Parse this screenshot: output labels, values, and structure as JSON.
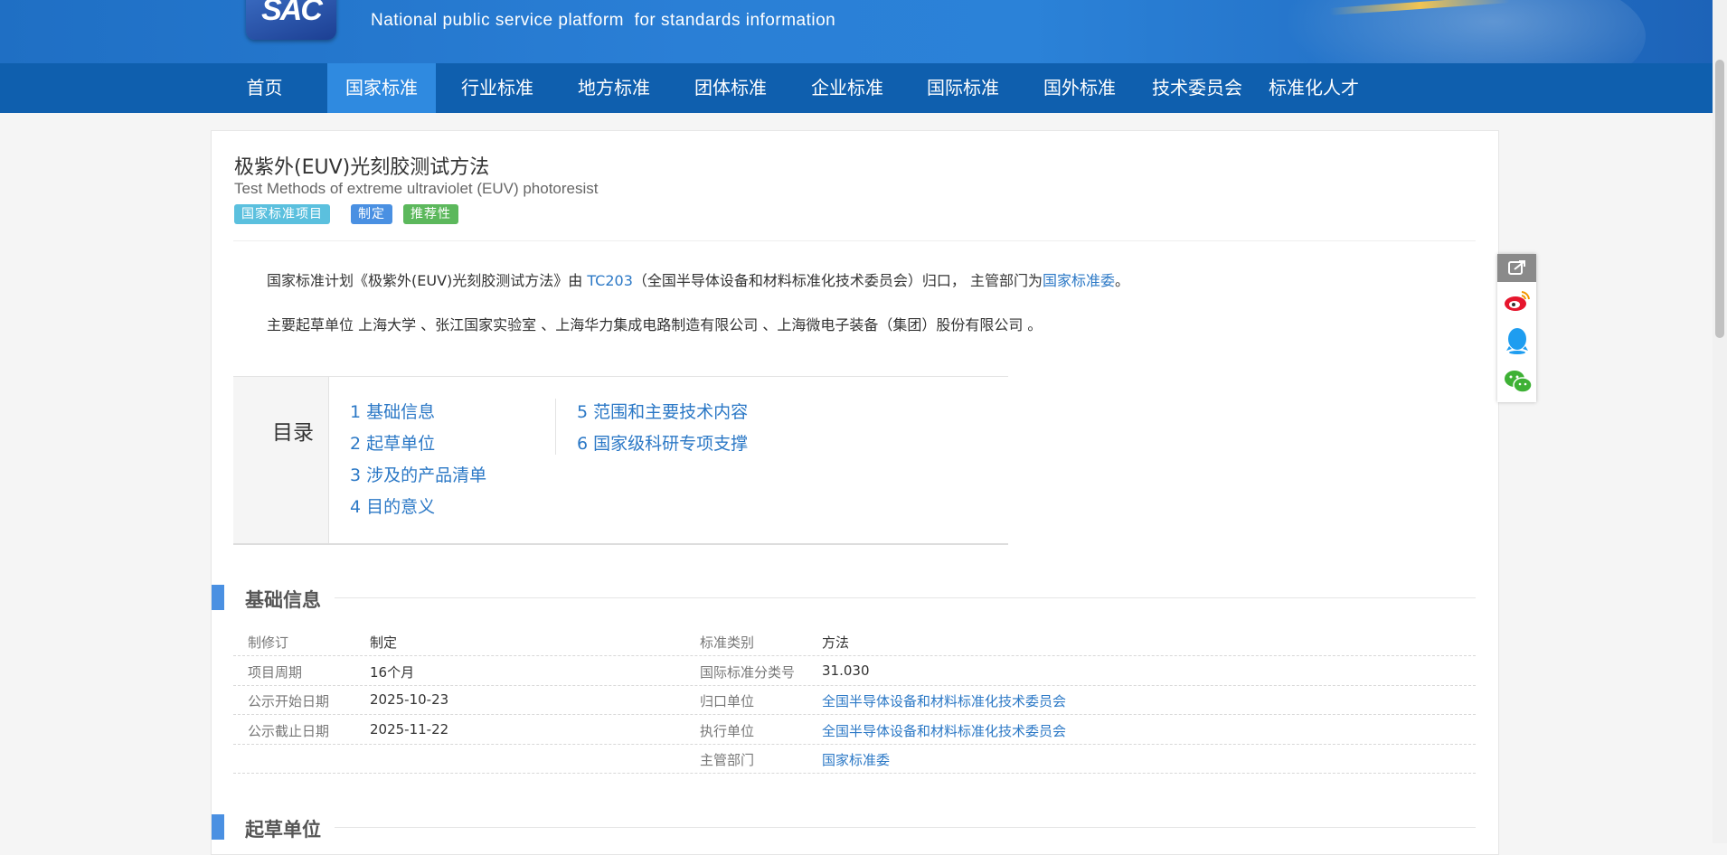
{
  "header": {
    "logo_text": "SAC",
    "tagline": "National public service platform  for standards information"
  },
  "nav": {
    "items": [
      "首页",
      "国家标准",
      "行业标准",
      "地方标准",
      "团体标准",
      "企业标准",
      "国际标准",
      "国外标准",
      "技术委员会",
      "标准化人才"
    ],
    "active": "国家标准"
  },
  "standard": {
    "title_cn": "极紫外(EUV)光刻胶测试方法",
    "title_en": "Test Methods of extreme ultraviolet (EUV) photoresist",
    "badges": [
      "国家标准项目",
      "制定",
      "推荐性"
    ],
    "badge_colors": [
      "#5bc0de",
      "#4a90e2",
      "#5cb85c"
    ]
  },
  "intro": {
    "p1_prefix": "国家标准计划《极紫外(EUV)光刻胶测试方法》由 ",
    "p1_tc": "TC203",
    "p1_mid": "（全国半导体设备和材料标准化技术委员会）归口， 主管部门为",
    "p1_dept": "国家标准委",
    "p1_end": "。",
    "p2": "主要起草单位 上海大学 、张江国家实验室 、上海华力集成电路制造有限公司 、上海微电子装备（集团）股份有限公司 。"
  },
  "toc": {
    "title": "目录",
    "items": [
      "1  基础信息",
      "2  起草单位",
      "3  涉及的产品清单",
      "4  目的意义",
      "5  范围和主要技术内容",
      "6  国家级科研专项支撑"
    ]
  },
  "sections": {
    "basic": "基础信息",
    "drafters": "起草单位"
  },
  "basic_info": {
    "left": [
      {
        "label": "制修订",
        "value": "制定"
      },
      {
        "label": "项目周期",
        "value": "16个月"
      },
      {
        "label": "公示开始日期",
        "value": "2025-10-23"
      },
      {
        "label": "公示截止日期",
        "value": "2025-11-22"
      }
    ],
    "right": [
      {
        "label": "标准类别",
        "value": "方法"
      },
      {
        "label": "国际标准分类号",
        "value": "31.030"
      },
      {
        "label": "归口单位",
        "value": "全国半导体设备和材料标准化技术委员会"
      },
      {
        "label": "执行单位",
        "value": "全国半导体设备和材料标准化技术委员会"
      },
      {
        "label": "主管部门",
        "value": "国家标准委"
      }
    ]
  },
  "share_icons": [
    "share-icon",
    "weibo-icon",
    "qq-icon",
    "wechat-icon"
  ]
}
